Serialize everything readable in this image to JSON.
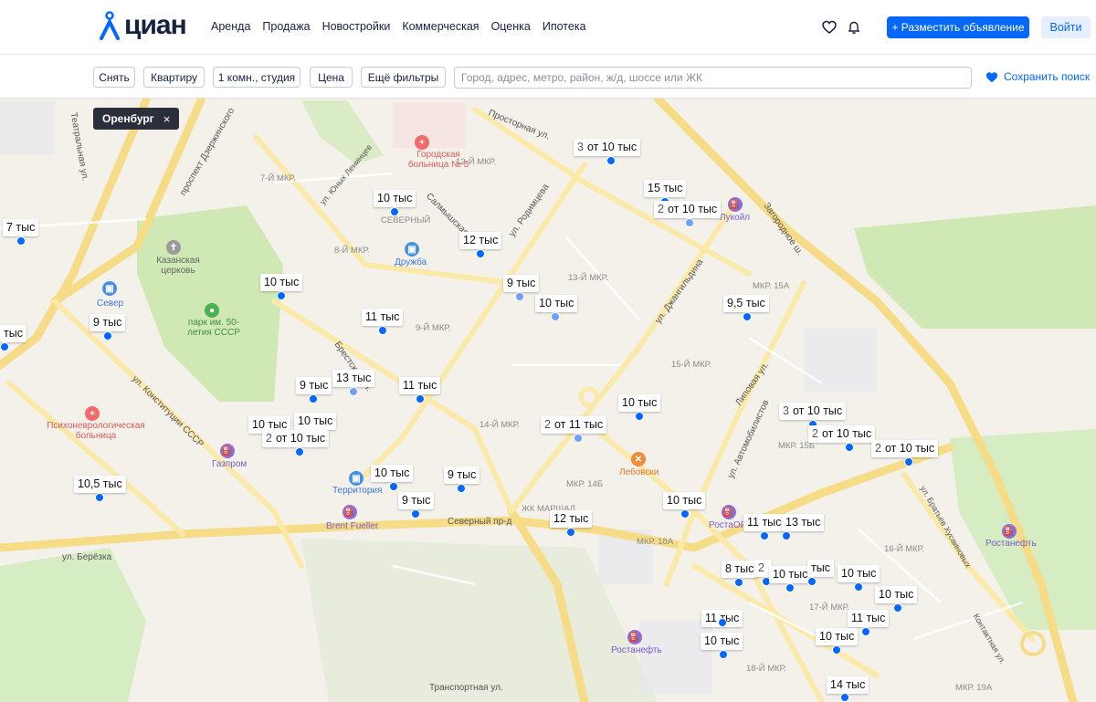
{
  "header": {
    "logo_text": "циан",
    "nav": [
      "Аренда",
      "Продажа",
      "Новостройки",
      "Коммерческая",
      "Оценка",
      "Ипотека"
    ],
    "post_button": "+ Разместить объявление",
    "login_button": "Войти"
  },
  "filters": {
    "deal": "Снять",
    "type": "Квартиру",
    "rooms": "1 комн., студия",
    "price": "Цена",
    "more": "Ещё фильтры",
    "search_placeholder": "Город, адрес, метро, район, ж/д, шоссе или ЖК",
    "save_search": "Сохранить поиск"
  },
  "map": {
    "region_chip": "Оренбург",
    "region_close": "×",
    "district_labels": [
      "7-Й МКР.",
      "12-Й МКР.",
      "СЕВЕРНЫЙ",
      "8-Й МКР.",
      "13-Й МКР.",
      "9-Й МКР.",
      "МКР. 15А",
      "15-Й МКР.",
      "14-Й МКР.",
      "МКР. 15Б",
      "МКР. 14Б",
      "ЖК МАРШАЛ",
      "МКР. 18А",
      "16-Й МКР.",
      "17-Й МКР.",
      "18-Й МКР.",
      "МКР. 19А"
    ],
    "poi_labels": [
      "Городская больница № 5",
      "Дружба",
      "Казанская церковь",
      "Север",
      "парк им. 50-летия СССР",
      "Психоневрологическая больница",
      "Газпром",
      "Территория",
      "Brent Fueller",
      "Лебовски",
      "Лукойл",
      "РостаОйл",
      "Ростанефть",
      "Ростанефть"
    ],
    "street_labels": [
      "Просторная ул.",
      "проспект Дзержинского",
      "ул. Юных Ленинцев",
      "Салмышская ул.",
      "ул. Родимцева",
      "ул. Джангильдина",
      "Загородное ш.",
      "Театральная ул.",
      "ул. Конституции СССР",
      "Брестская ул.",
      "Северный пр-д",
      "ул. Берёзка",
      "Липовая ул.",
      "ул. Автомобилистов",
      "ул. Братьев Хусаиновых",
      "Контактная ул.",
      "Транспортная ул."
    ],
    "pins": [
      {
        "count": "3",
        "price": "от 10 тыс"
      },
      {
        "count": "",
        "price": "10 тыс"
      },
      {
        "count": "",
        "price": "15 тыс"
      },
      {
        "count": "2",
        "price": "от 10 тыс"
      },
      {
        "count": "",
        "price": "7 тыс"
      },
      {
        "count": "",
        "price": "12 тыс"
      },
      {
        "count": "",
        "price": "10 тыс"
      },
      {
        "count": "",
        "price": "9 тыс"
      },
      {
        "count": "",
        "price": "10 тыс"
      },
      {
        "count": "",
        "price": "9,5 тыс"
      },
      {
        "count": "",
        "price": "9 тыс"
      },
      {
        "count": "",
        "price": "11 тыс"
      },
      {
        "count": "",
        "price": "тыс"
      },
      {
        "count": "",
        "price": "9 тыс"
      },
      {
        "count": "",
        "price": "13 тыс"
      },
      {
        "count": "",
        "price": "11 тыс"
      },
      {
        "count": "",
        "price": "10 тыс"
      },
      {
        "count": "3",
        "price": "от 10 тыс"
      },
      {
        "count": "",
        "price": "10 тыс"
      },
      {
        "count": "",
        "price": "10 тыс"
      },
      {
        "count": "2",
        "price": "от 10 тыс"
      },
      {
        "count": "2",
        "price": "от 11 тыс"
      },
      {
        "count": "2",
        "price": "от 10 тыс"
      },
      {
        "count": "2",
        "price": "от 10 тыс"
      },
      {
        "count": "",
        "price": "10,5 тыс"
      },
      {
        "count": "",
        "price": "10 тыс"
      },
      {
        "count": "",
        "price": "9 тыс"
      },
      {
        "count": "",
        "price": "9 тыс"
      },
      {
        "count": "",
        "price": "10 тыс"
      },
      {
        "count": "",
        "price": "12 тыс"
      },
      {
        "count": "",
        "price": "11 тыс"
      },
      {
        "count": "",
        "price": "13 тыс"
      },
      {
        "count": "",
        "price": "8 тыс"
      },
      {
        "count": "2",
        "price": ""
      },
      {
        "count": "",
        "price": "10 тыс"
      },
      {
        "count": "",
        "price": "тыс"
      },
      {
        "count": "",
        "price": "10 тыс"
      },
      {
        "count": "",
        "price": "10 тыс"
      },
      {
        "count": "",
        "price": "11 тыс"
      },
      {
        "count": "",
        "price": "11 тыс"
      },
      {
        "count": "",
        "price": "10 тыс"
      },
      {
        "count": "",
        "price": "10 тыс"
      },
      {
        "count": "",
        "price": "14 тыс"
      }
    ]
  },
  "colors": {
    "accent": "#0468ff",
    "pin_dot": "#0468ff",
    "map_bg": "#f3f1ea",
    "road_major": "#f5d879",
    "park": "#cfe8b4",
    "chip_bg": "#2b2f3a"
  }
}
